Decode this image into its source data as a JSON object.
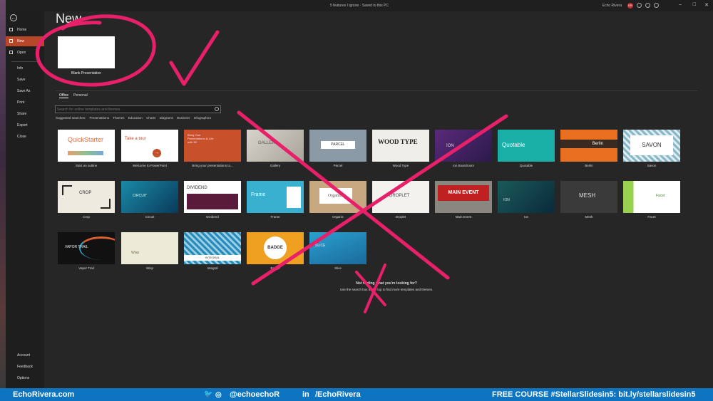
{
  "titlebar": {
    "doc_title": "5 features I ignore  ·  Saved to this PC",
    "user": "Echo Rivera",
    "avatar": "ER"
  },
  "sidebar": {
    "items": [
      {
        "label": "Home",
        "icon": "home-icon"
      },
      {
        "label": "New",
        "icon": "new-file-icon",
        "active": true
      },
      {
        "label": "Open",
        "icon": "folder-icon"
      }
    ],
    "secondary": [
      "Info",
      "Save",
      "Save As",
      "Print",
      "Share",
      "Export",
      "Close"
    ],
    "bottom": [
      "Account",
      "Feedback",
      "Options"
    ]
  },
  "main": {
    "title": "New",
    "blank": {
      "label": "Blank Presentation"
    },
    "tabs": [
      "Office",
      "Personal"
    ],
    "search_placeholder": "Search for online templates and themes",
    "suggested_label": "Suggested searches:",
    "suggested": [
      "Presentations",
      "Themes",
      "Education",
      "Charts",
      "Diagrams",
      "Business",
      "Infographics"
    ],
    "not_finding_title": "Not finding what you're looking for?",
    "not_finding_text": "Use the search box at the top to find more templates and themes."
  },
  "templates": [
    {
      "name": "Start an outline",
      "thumb": "QuickStarter"
    },
    {
      "name": "Welcome to PowerPoint",
      "thumb": "Take a tour"
    },
    {
      "name": "Bring your presentations to...",
      "thumb": "Bring Your Presentations to Life with 3D"
    },
    {
      "name": "Gallery",
      "thumb": "GALLERY"
    },
    {
      "name": "Parcel",
      "thumb": "PARCEL"
    },
    {
      "name": "Wood Type",
      "thumb": "WOOD TYPE"
    },
    {
      "name": "Ion Boardroom",
      "thumb": "ION"
    },
    {
      "name": "Quotable",
      "thumb": "Quotable"
    },
    {
      "name": "Berlin",
      "thumb": "Berlin"
    },
    {
      "name": "Savon",
      "thumb": "SAVON"
    },
    {
      "name": "Crop",
      "thumb": "CROP"
    },
    {
      "name": "Circuit",
      "thumb": "CIRCUIT"
    },
    {
      "name": "Dividend",
      "thumb": "DIVIDEND"
    },
    {
      "name": "Frame",
      "thumb": "Frame"
    },
    {
      "name": "Organic",
      "thumb": "Organic"
    },
    {
      "name": "Droplet",
      "thumb": "DROPLET"
    },
    {
      "name": "Main Event",
      "thumb": "MAIN EVENT"
    },
    {
      "name": "Ion",
      "thumb": "ION"
    },
    {
      "name": "Mesh",
      "thumb": "MESH"
    },
    {
      "name": "Facet",
      "thumb": "Facet"
    },
    {
      "name": "Vapor Trail",
      "thumb": "VAPOR TRAIL"
    },
    {
      "name": "Wisp",
      "thumb": "Wisp"
    },
    {
      "name": "Integral",
      "thumb": "INTEGRAL"
    },
    {
      "name": "Badge",
      "thumb": "BADGE"
    },
    {
      "name": "Slice",
      "thumb": "SLICE"
    }
  ],
  "footer": {
    "site": "EchoRivera.com",
    "twitter": "@echoechoR",
    "linkedin": "/EchoRivera",
    "course": "FREE COURSE #StellarSlidesin5: bit.ly/stellarslidesin5"
  },
  "colors": {
    "accent": "#b7472a",
    "annotation": "#e8206a",
    "footer": "#0c74c0"
  }
}
